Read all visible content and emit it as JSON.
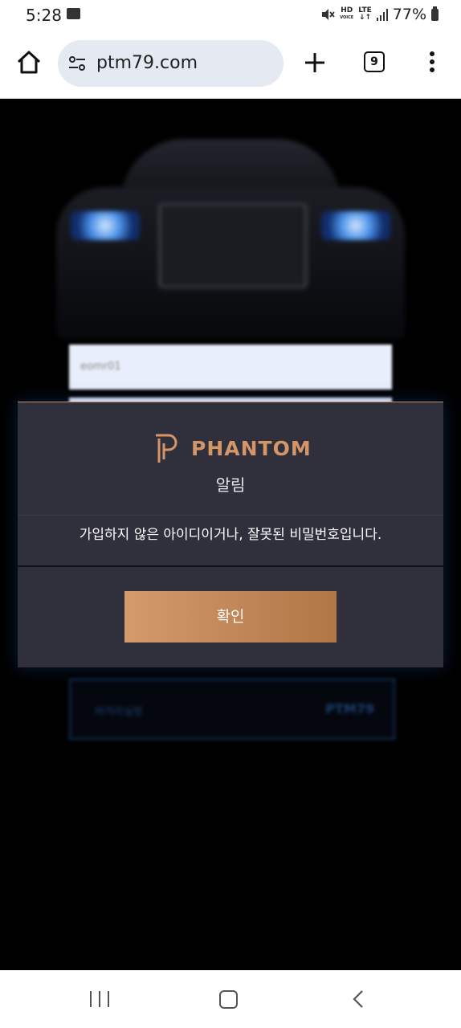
{
  "status_bar": {
    "time": "5:28",
    "network_hd": "HD",
    "network_voice": "VOICE",
    "network_lte": "LTE",
    "battery": "77%"
  },
  "browser": {
    "url": "ptm79.com",
    "tab_count": "9"
  },
  "background_page": {
    "username_value": "eomr01",
    "bottom_box_left": "바카라실방",
    "bottom_box_right": "PTM79"
  },
  "modal": {
    "brand": "PHANTOM",
    "title": "알림",
    "message": "가입하지 않은 아이디이거나, 잘못된 비밀번호입니다.",
    "confirm_label": "확인",
    "accent_color": "#c9916a"
  }
}
